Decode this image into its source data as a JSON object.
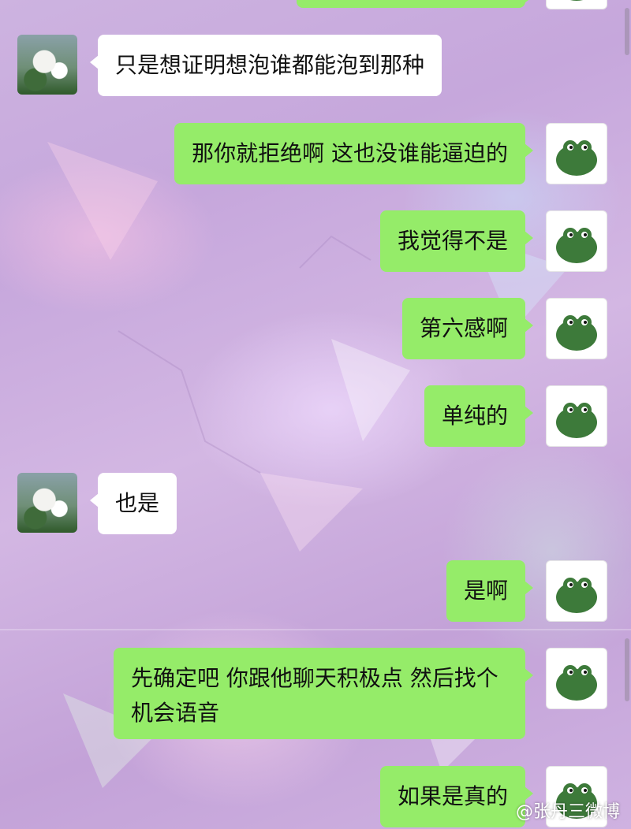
{
  "messages": [
    {
      "sender": "me",
      "text": ""
    },
    {
      "sender": "them",
      "text": "只是想证明想泡谁都能泡到那种"
    },
    {
      "sender": "me",
      "text": "那你就拒绝啊 这也没谁能逼迫的"
    },
    {
      "sender": "me",
      "text": "我觉得不是"
    },
    {
      "sender": "me",
      "text": "第六感啊"
    },
    {
      "sender": "me",
      "text": "单纯的"
    },
    {
      "sender": "them",
      "text": "也是"
    },
    {
      "sender": "me",
      "text": "是啊"
    },
    {
      "sender": "me",
      "text": "先确定吧 你跟他聊天积极点 然后找个机会语音"
    },
    {
      "sender": "me",
      "text": "如果是真的"
    }
  ],
  "watermark": "@张丹三微博",
  "colors": {
    "my_bubble": "#95ec69",
    "their_bubble": "#ffffff",
    "background": "#c9ade0"
  },
  "icons": {
    "my_avatar": "green-frog-avatar-icon",
    "their_avatar": "flower-portrait-avatar-icon"
  }
}
